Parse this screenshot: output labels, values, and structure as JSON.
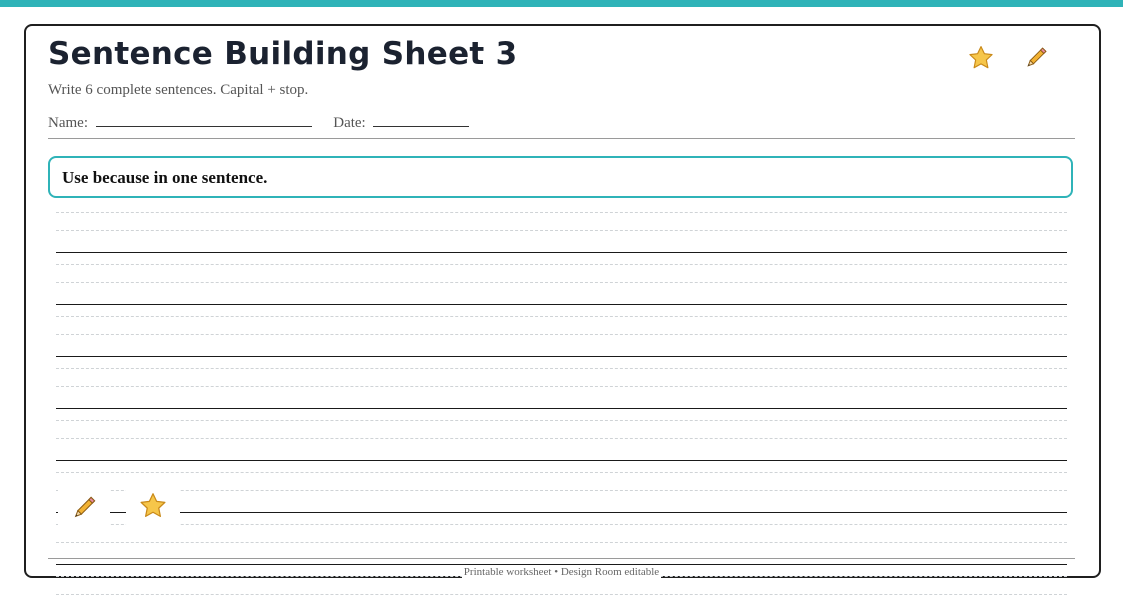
{
  "worksheet": {
    "title": "Sentence Building Sheet 3",
    "instructions": "Write 6 complete sentences. Capital + stop.",
    "name_label": "Name:",
    "date_label": "Date:",
    "prompt": "Use because in one sentence.",
    "footer": "Printable worksheet • Design Room editable",
    "header_icons": [
      "star-icon",
      "pencil-icon"
    ],
    "inline_icons": [
      "pencil-icon",
      "star-icon"
    ],
    "writing_lines_count": 6
  },
  "colors": {
    "accent": "#2fb3b8",
    "title": "#1b2230",
    "text_muted": "#555555",
    "star": "#f6c64a",
    "pencil": "#f2b233"
  }
}
